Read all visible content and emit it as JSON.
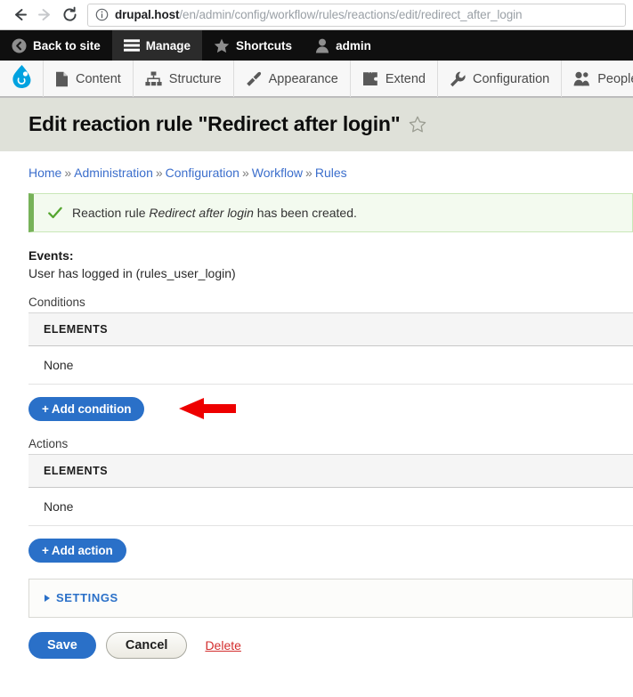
{
  "browser": {
    "back_icon": "arrow-left-icon",
    "forward_icon": "arrow-right-icon",
    "reload_icon": "reload-icon",
    "site_info_icon": "info-circle-icon",
    "url_host": "drupal.host",
    "url_path": "/en/admin/config/workflow/rules/reactions/edit/redirect_after_login"
  },
  "admin_toolbar": {
    "items": [
      {
        "label": "Back to site",
        "icon": "back-circle-icon",
        "active": false
      },
      {
        "label": "Manage",
        "icon": "hamburger-icon",
        "active": true
      },
      {
        "label": "Shortcuts",
        "icon": "star-icon",
        "active": false
      },
      {
        "label": "admin",
        "icon": "user-icon",
        "active": false
      }
    ]
  },
  "menu_bar": {
    "logo_icon": "drupal-drop-icon",
    "items": [
      {
        "label": "Content",
        "icon": "file-icon"
      },
      {
        "label": "Structure",
        "icon": "sitemap-icon"
      },
      {
        "label": "Appearance",
        "icon": "paintbrush-icon"
      },
      {
        "label": "Extend",
        "icon": "puzzle-icon"
      },
      {
        "label": "Configuration",
        "icon": "wrench-icon"
      },
      {
        "label": "People",
        "icon": "people-icon"
      }
    ]
  },
  "page": {
    "title": "Edit reaction rule \"Redirect after login\"",
    "shortcut_star_icon": "star-outline-icon"
  },
  "breadcrumb": {
    "items": [
      "Home",
      "Administration",
      "Configuration",
      "Workflow",
      "Rules"
    ],
    "separator": "»"
  },
  "status_message": {
    "icon": "checkmark-icon",
    "prefix": "Reaction rule",
    "emphasis": "Redirect after login",
    "suffix": "has been created."
  },
  "events": {
    "label": "Events:",
    "value": "User has logged in (rules_user_login)"
  },
  "conditions": {
    "label": "Conditions",
    "column_header": "ELEMENTS",
    "row_value": "None",
    "add_button": "+ Add condition"
  },
  "actions": {
    "label": "Actions",
    "column_header": "ELEMENTS",
    "row_value": "None",
    "add_button": "+ Add action"
  },
  "settings": {
    "summary": "SETTINGS",
    "expanded": false,
    "toggle_icon": "triangle-right-icon"
  },
  "form_actions": {
    "save": "Save",
    "cancel": "Cancel",
    "delete": "Delete"
  },
  "annotation": {
    "arrow_icon": "arrow-left-annotation",
    "color": "#ee0000"
  },
  "colors": {
    "accent_blue": "#2a70c8",
    "title_band": "#dfe1d9",
    "status_green_border": "#77b259",
    "status_green_bg": "#f3faef",
    "delete_red": "#d32d2d",
    "toolbar_black": "#0f0f0f"
  }
}
